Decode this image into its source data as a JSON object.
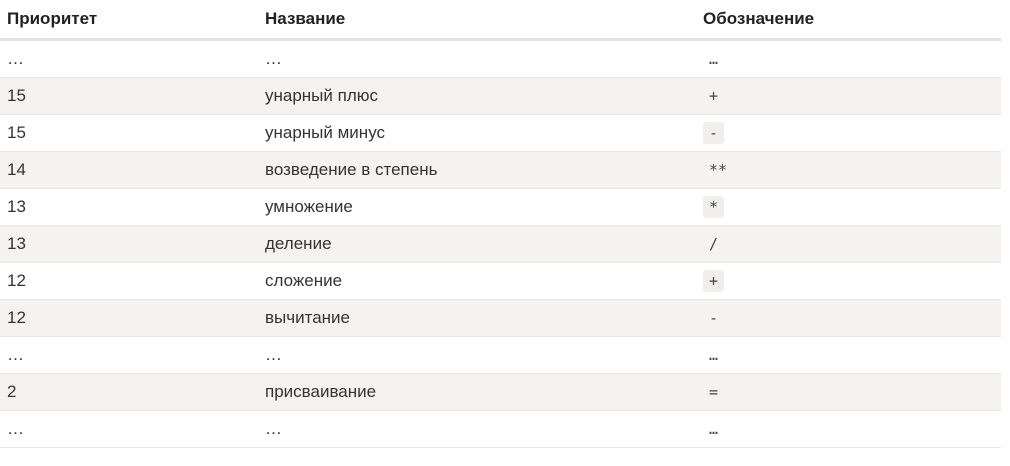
{
  "header": {
    "priority": "Приоритет",
    "name": "Название",
    "symbol": "Обозначение"
  },
  "rows": [
    {
      "priority": "…",
      "name": "…",
      "symbol": "…",
      "boxed": false
    },
    {
      "priority": "15",
      "name": "унарный плюс",
      "symbol": "+",
      "boxed": false
    },
    {
      "priority": "15",
      "name": "унарный минус",
      "symbol": "-",
      "boxed": true
    },
    {
      "priority": "14",
      "name": "возведение в степень",
      "symbol": "**",
      "boxed": false
    },
    {
      "priority": "13",
      "name": "умножение",
      "symbol": "*",
      "boxed": true
    },
    {
      "priority": "13",
      "name": "деление",
      "symbol": "/",
      "boxed": false
    },
    {
      "priority": "12",
      "name": "сложение",
      "symbol": "+",
      "boxed": true
    },
    {
      "priority": "12",
      "name": "вычитание",
      "symbol": "-",
      "boxed": false
    },
    {
      "priority": "…",
      "name": "…",
      "symbol": "…",
      "boxed": false
    },
    {
      "priority": "2",
      "name": "присваивание",
      "symbol": "=",
      "boxed": false
    },
    {
      "priority": "…",
      "name": "…",
      "symbol": "…",
      "boxed": false
    }
  ]
}
